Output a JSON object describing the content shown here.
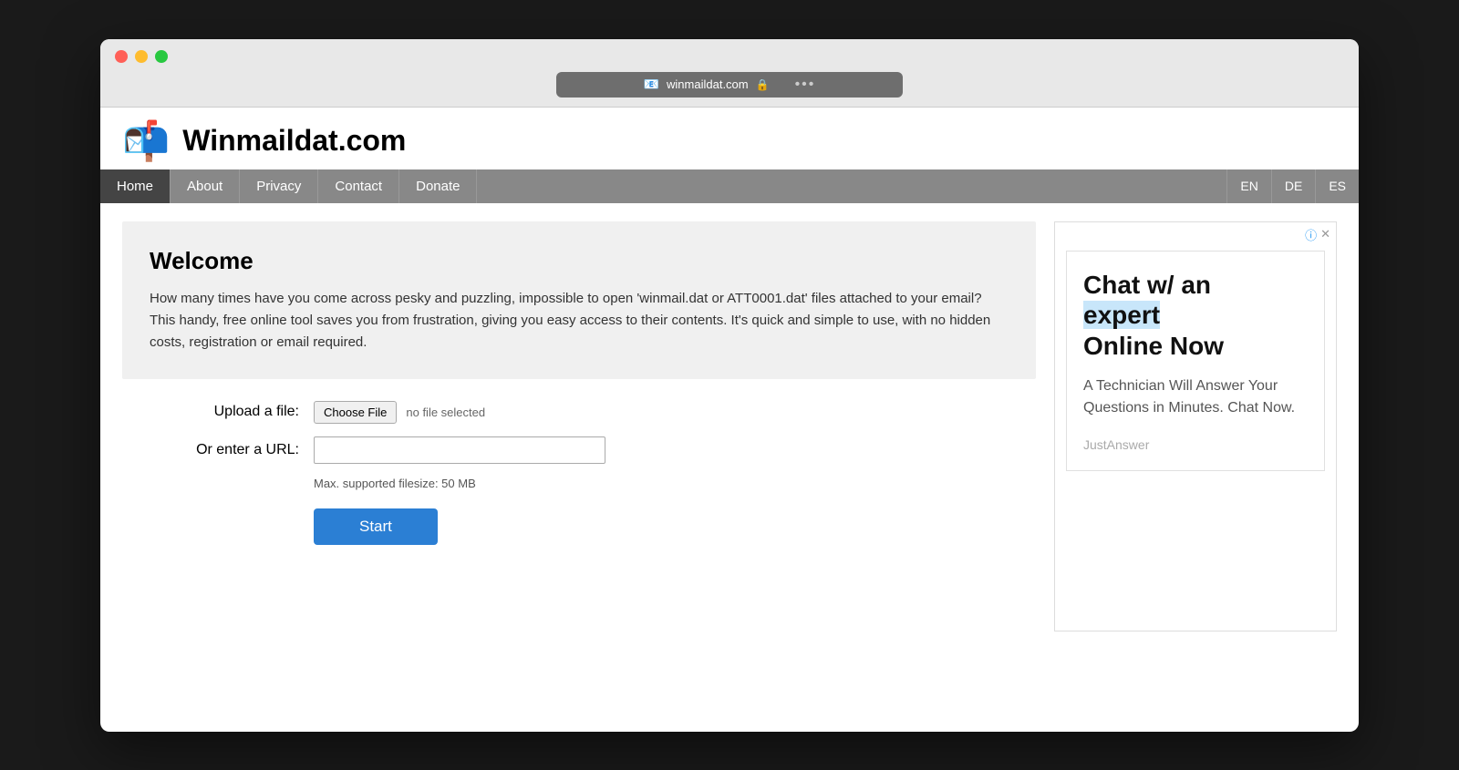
{
  "browser": {
    "favicon": "📧",
    "url": "winmaildat.com",
    "lock": "🔒",
    "dots": "•••"
  },
  "site": {
    "logo": "📬",
    "title": "Winmaildat.com"
  },
  "nav": {
    "items": [
      {
        "label": "Home",
        "active": true
      },
      {
        "label": "About",
        "active": false
      },
      {
        "label": "Privacy",
        "active": false
      },
      {
        "label": "Contact",
        "active": false
      },
      {
        "label": "Donate",
        "active": false
      }
    ],
    "languages": [
      "EN",
      "DE",
      "ES"
    ]
  },
  "welcome": {
    "title": "Welcome",
    "text": "How many times have you come across pesky and puzzling, impossible to open 'winmail.dat or ATT0001.dat' files attached to your email? This handy, free online tool saves you from frustration, giving you easy access to their contents. It's quick and simple to use, with no hidden costs, registration or email required."
  },
  "form": {
    "upload_label": "Upload a file:",
    "choose_file_btn": "Choose File",
    "no_file_text": "no file selected",
    "url_label": "Or enter a URL:",
    "url_placeholder": "",
    "file_size_note": "Max. supported filesize: 50 MB",
    "start_btn": "Start"
  },
  "ad": {
    "headline_part1": "Chat w/ an",
    "headline_part2": "expert",
    "headline_part3": "Online Now",
    "highlight": "expert",
    "subtext": "A Technician Will Answer Your Questions in Minutes. Chat Now.",
    "source": "JustAnswer"
  }
}
